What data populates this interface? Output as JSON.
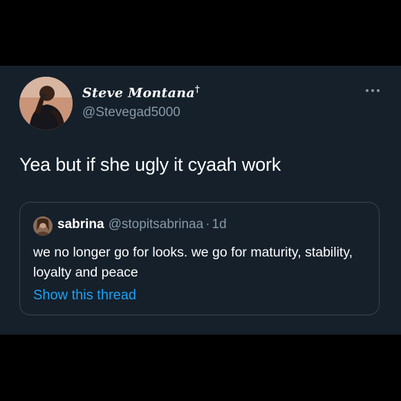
{
  "tweet": {
    "author": {
      "display_name": "Steve Montana",
      "badge": "†",
      "handle": "@Stevegad5000",
      "avatar_icon": "profile-photo"
    },
    "more_icon": "ellipsis-icon",
    "text": "Yea but if she ugly it cyaah work"
  },
  "quoted_tweet": {
    "author": {
      "display_name": "sabrina",
      "handle": "@stopitsabrinaa",
      "separator": "·",
      "time": "1d",
      "avatar_icon": "profile-photo"
    },
    "text": "we no longer go for looks. we go for maturity, stability, loyalty and peace",
    "show_thread_label": "Show this thread"
  },
  "colors": {
    "background": "#000000",
    "card": "#15202b",
    "text_primary": "#ffffff",
    "text_secondary": "#8899a6",
    "border": "#38444d",
    "link": "#1da1f2"
  }
}
